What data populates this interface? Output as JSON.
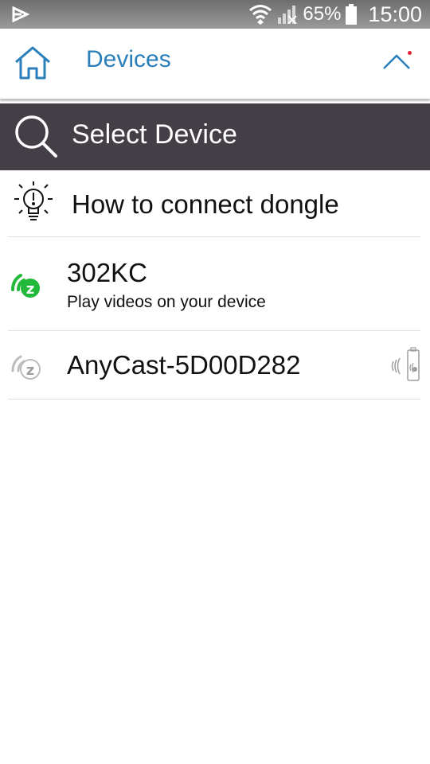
{
  "status_bar": {
    "battery_percent": "65%",
    "time": "15:00",
    "icons": [
      "notification-icon",
      "wifi-icon",
      "signal-icon",
      "battery-icon"
    ]
  },
  "header": {
    "title": "Devices",
    "icons": [
      "home-icon",
      "chevron-up-icon"
    ],
    "accent_color": "#2a7fba",
    "notification_dot_color": "#e2263a"
  },
  "search_bar": {
    "label": "Select Device",
    "icon": "search-icon",
    "background_color": "#443f47"
  },
  "list": {
    "help_item": {
      "label": "How to connect dongle",
      "icon": "lightbulb-icon"
    },
    "devices": [
      {
        "name": "302KC",
        "subtitle": "Play videos on your device",
        "icon": "cast-active-icon",
        "icon_color": "#22b83a"
      },
      {
        "name": "AnyCast-5D00D282",
        "subtitle": "",
        "icon": "cast-inactive-icon",
        "trailing_icon": "dongle-signal-icon"
      }
    ]
  }
}
